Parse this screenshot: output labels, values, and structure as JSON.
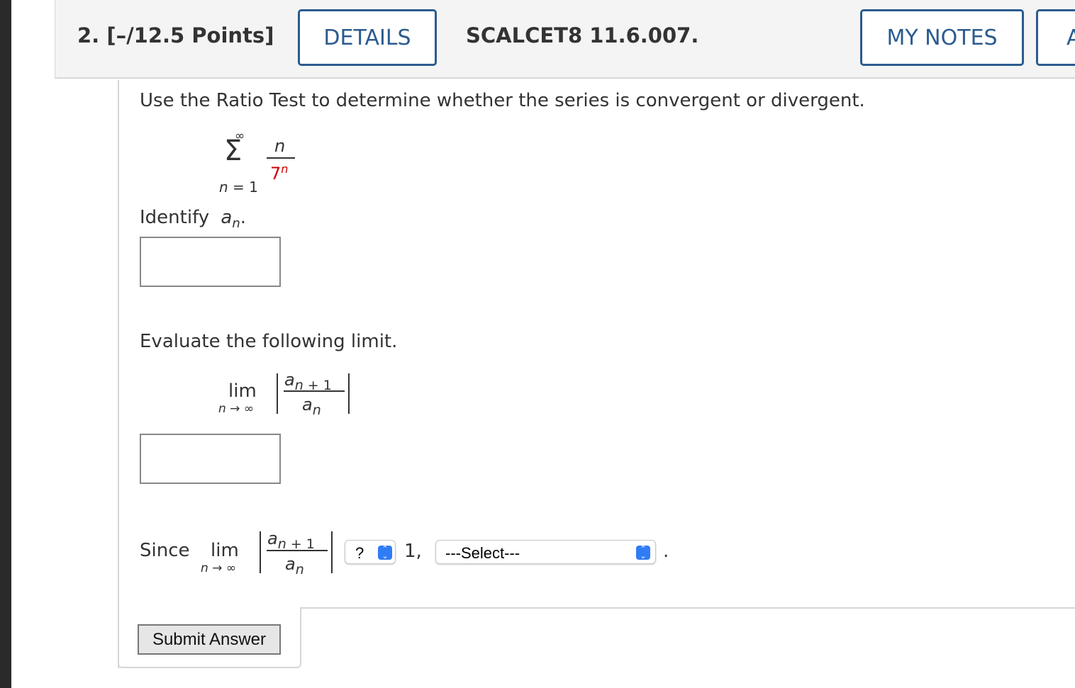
{
  "header": {
    "question_number": "2.",
    "points": "[–/12.5 Points]",
    "details_label": "DETAILS",
    "problem_code": "SCALCET8 11.6.007.",
    "my_notes_label": "MY NOTES",
    "ask_label": "A"
  },
  "question": {
    "instruction": "Use the Ratio Test to determine whether the series is convergent or divergent.",
    "series": {
      "upper": "∞",
      "sigma": "Σ",
      "lower": "n = 1",
      "numerator": "n",
      "denominator_base": "7",
      "denominator_exp": "n"
    },
    "identify_prefix": "Identify",
    "identify_symbol": "a",
    "identify_sub": "n",
    "identify_suffix": ".",
    "evaluate_label": "Evaluate the following limit.",
    "limit": {
      "lim": "lim",
      "under": "n → ∞",
      "num_a": "a",
      "num_sub": "n + 1",
      "den_a": "a",
      "den_sub": "n"
    },
    "since_label": "Since",
    "compare_select": "?",
    "compare_value": "1,",
    "conclusion_select": "---Select---",
    "end_period": "."
  },
  "submit_label": "Submit Answer",
  "colors": {
    "accent": "#2b5b8f",
    "select_arrow": "#2f7cf6",
    "highlight": "#cc0000"
  }
}
